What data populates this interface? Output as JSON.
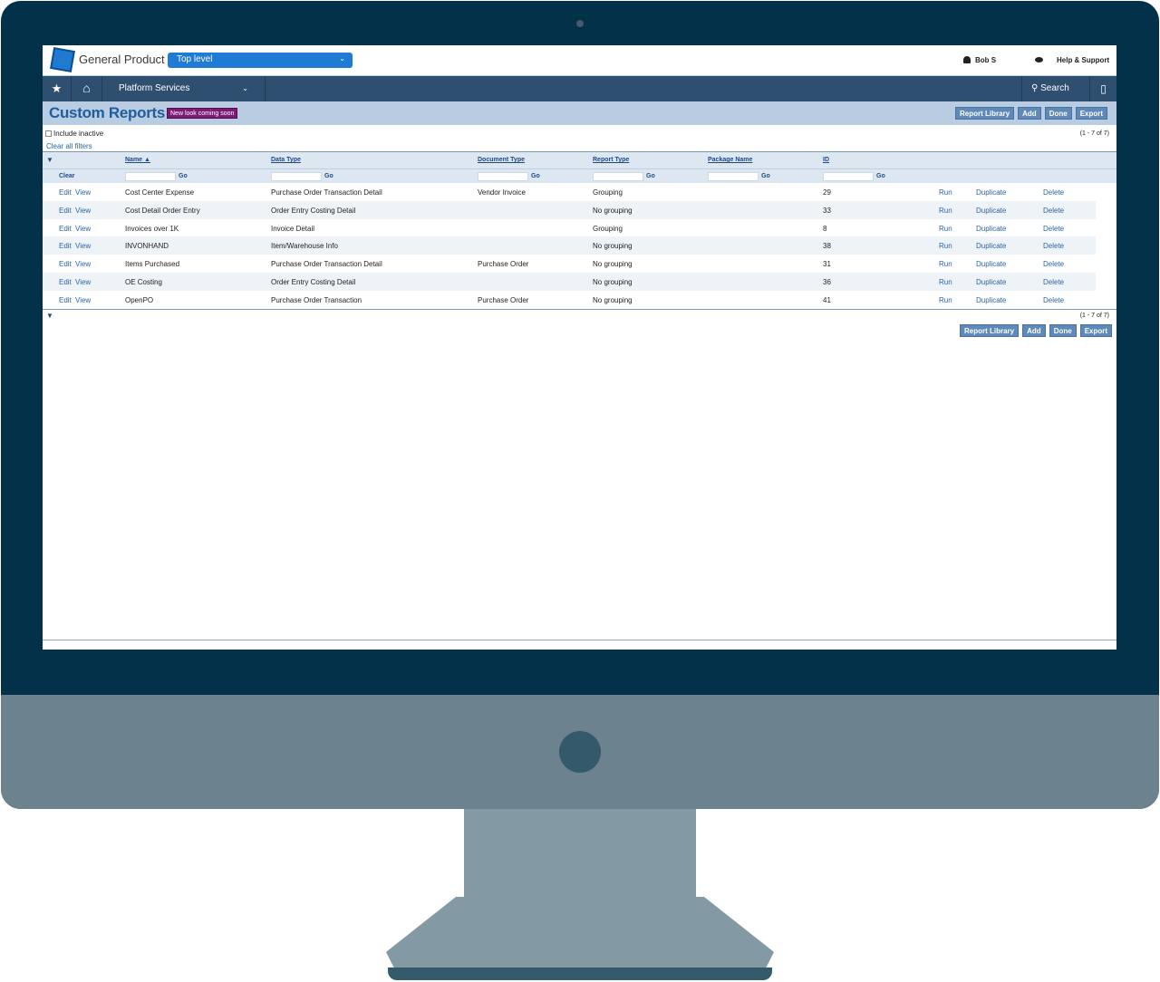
{
  "app": {
    "product_name": "General Product",
    "level_select": "Top level",
    "user_name": "Bob S",
    "help_label": "Help & Support"
  },
  "nav": {
    "platform_label": "Platform Services",
    "search_label": "Search"
  },
  "page": {
    "title": "Custom Reports",
    "badge": "New look coming soon",
    "include_inactive_label": "Include inactive",
    "clear_all_filters": "Clear all filters",
    "count_label": "(1 - 7 of 7)"
  },
  "buttons": {
    "report_library": "Report Library",
    "add": "Add",
    "done": "Done",
    "export": "Export"
  },
  "grid": {
    "columns": {
      "name": "Name ▲",
      "data_type": "Data Type",
      "document_type": "Document Type",
      "report_type": "Report Type",
      "package_name": "Package Name",
      "id": "ID"
    },
    "clear_label": "Clear",
    "go_label": "Go",
    "action_labels": {
      "edit": "Edit",
      "view": "View",
      "run": "Run",
      "duplicate": "Duplicate",
      "delete": "Delete"
    },
    "rows": [
      {
        "name": "Cost Center Expense",
        "data_type": "Purchase Order Transaction Detail",
        "document_type": "Vendor Invoice",
        "report_type": "Grouping",
        "package_name": "",
        "id": "29"
      },
      {
        "name": "Cost Detail Order Entry",
        "data_type": "Order Entry Costing Detail",
        "document_type": "",
        "report_type": "No grouping",
        "package_name": "",
        "id": "33"
      },
      {
        "name": "Invoices over 1K",
        "data_type": "Invoice Detail",
        "document_type": "",
        "report_type": "Grouping",
        "package_name": "",
        "id": "8"
      },
      {
        "name": "INVONHAND",
        "data_type": "Item/Warehouse Info",
        "document_type": "",
        "report_type": "No grouping",
        "package_name": "",
        "id": "38"
      },
      {
        "name": "Items Purchased",
        "data_type": "Purchase Order Transaction Detail",
        "document_type": "Purchase Order",
        "report_type": "No grouping",
        "package_name": "",
        "id": "31"
      },
      {
        "name": "OE Costing",
        "data_type": "Order Entry Costing Detail",
        "document_type": "",
        "report_type": "No grouping",
        "package_name": "",
        "id": "36"
      },
      {
        "name": "OpenPO",
        "data_type": "Purchase Order Transaction",
        "document_type": "Purchase Order",
        "report_type": "No grouping",
        "package_name": "",
        "id": "41"
      }
    ]
  },
  "colors": {
    "monitor_frame": "#04314a",
    "nav_bar": "#2f4f71",
    "title_bar": "#b9cce2",
    "accent_blue": "#1f7bd3",
    "badge_purple": "#7c1b74",
    "link_blue": "#2a64a8"
  },
  "icons": [
    "star-icon",
    "home-icon",
    "chevron-down-icon",
    "search-icon",
    "bookmark-icon",
    "user-icon",
    "chat-icon",
    "sort-asc-icon",
    "expand-triangle-icon"
  ]
}
